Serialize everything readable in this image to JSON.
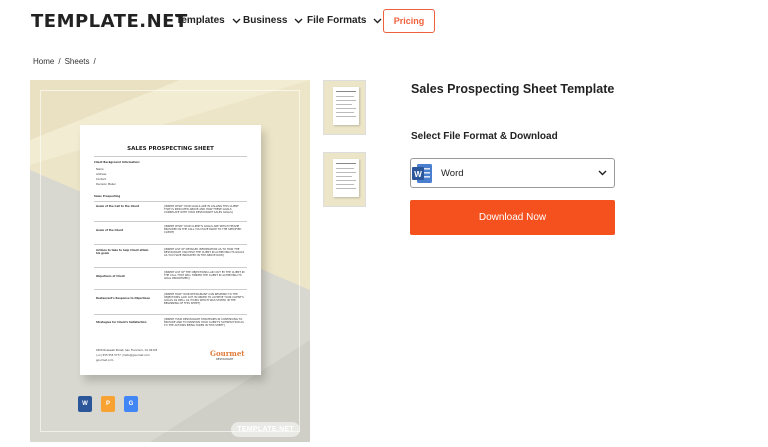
{
  "header": {
    "logo": "TEMPLATE.NET",
    "nav": [
      {
        "label": "Templates"
      },
      {
        "label": "Business"
      },
      {
        "label": "File Formats"
      }
    ],
    "pricing": "Pricing"
  },
  "breadcrumb": {
    "items": [
      "Home",
      "Sheets"
    ],
    "separator": "/"
  },
  "preview": {
    "sheet_title": "SALES PROSPECTING SHEET",
    "client_info_heading": "Client Background Information:",
    "client_fields": [
      "Name",
      "Address",
      "Contact",
      "Decision Maker"
    ],
    "section_heading": "Sales Prospecting",
    "rows": [
      {
        "label": "Goals of the Call to the Client",
        "text": "[INSERT WHAT YOUR GOALS ARE IN CALLING THIS CLIENT THAT IS INDICATED ABOVE AND HOW THESE GOALS CORRELATE WITH YOUR RESTAURANT SALES GOALS]"
      },
      {
        "label": "Goals of the Client",
        "text": "[INSERT WHAT YOUR CLIENT'S GOALS ARE WHICH HE/SHE PROVIDED IN THE CALL YOU HAVE MADE TO THE SPECIFIED CLIENT]"
      },
      {
        "label": "Actions to take to help Client attain his goals",
        "text": "[INSERT LIST OF DETAILED INFORMATION AS TO HOW THE RESTAURANT CAN HELP THE CLIENT IN ACHIEVING ITS GOALS AS YOU HAVE INDICATED IN THE ABOVE ROW]"
      },
      {
        "label": "Objections of Client",
        "text": "[INSERT LIST OF THE OBJECTIONS LAID OUT BY THE CLIENT IN THE CALL THAT WILL HINDER THE CLIENT IN ACHIEVING ITS GOAL PRIORITIZED]"
      },
      {
        "label": "Restaurant's Response to Objections",
        "text": "[INSERT HOW YOUR RESTAURANT CAN RESPOND TO THE OBJECTIONS LAID OUT IN ORDER TO ACHIEVE YOUR CLIENT'S GOALS AS WELL AS YOURS WHICH WAS STATED IN THE BEGINNING OF THIS SHEET]"
      },
      {
        "label": "Strategies for Client's Satisfaction",
        "text": "[INSERT YOUR RESTAURANT STRATEGIES IN CONTINUING TO PROVIDE AND TO MAINTAIN YOUR CLIENT'S SATISFACTION AS TO THE ACTIONS BEING TAKEN IN THIS SHEET]"
      }
    ],
    "footer_address": "0456 Rosewell Street, San Francisco, CA 94103",
    "footer_phone": "(+1) 555 555 5777 | hello@gourmet.com",
    "footer_web": "gourmet.com",
    "brand": "Gourmet",
    "brand_sub": "RESTAURANT",
    "watermark": "TEMPLATE.NET",
    "format_icons": [
      {
        "name": "word",
        "letter": "W",
        "color": "#2b579a"
      },
      {
        "name": "pages",
        "letter": "P",
        "color": "#f7a233"
      },
      {
        "name": "google-docs",
        "letter": "G",
        "color": "#4285f4"
      }
    ]
  },
  "product": {
    "title": "Sales Prospecting Sheet Template",
    "select_label": "Select File Format & Download",
    "selected_format": "Word",
    "download_label": "Download Now"
  },
  "colors": {
    "accent": "#f4511e",
    "pricing_border": "#f0603a",
    "preview_bg": "#ede5c8",
    "word_blue": "#2b579a"
  }
}
